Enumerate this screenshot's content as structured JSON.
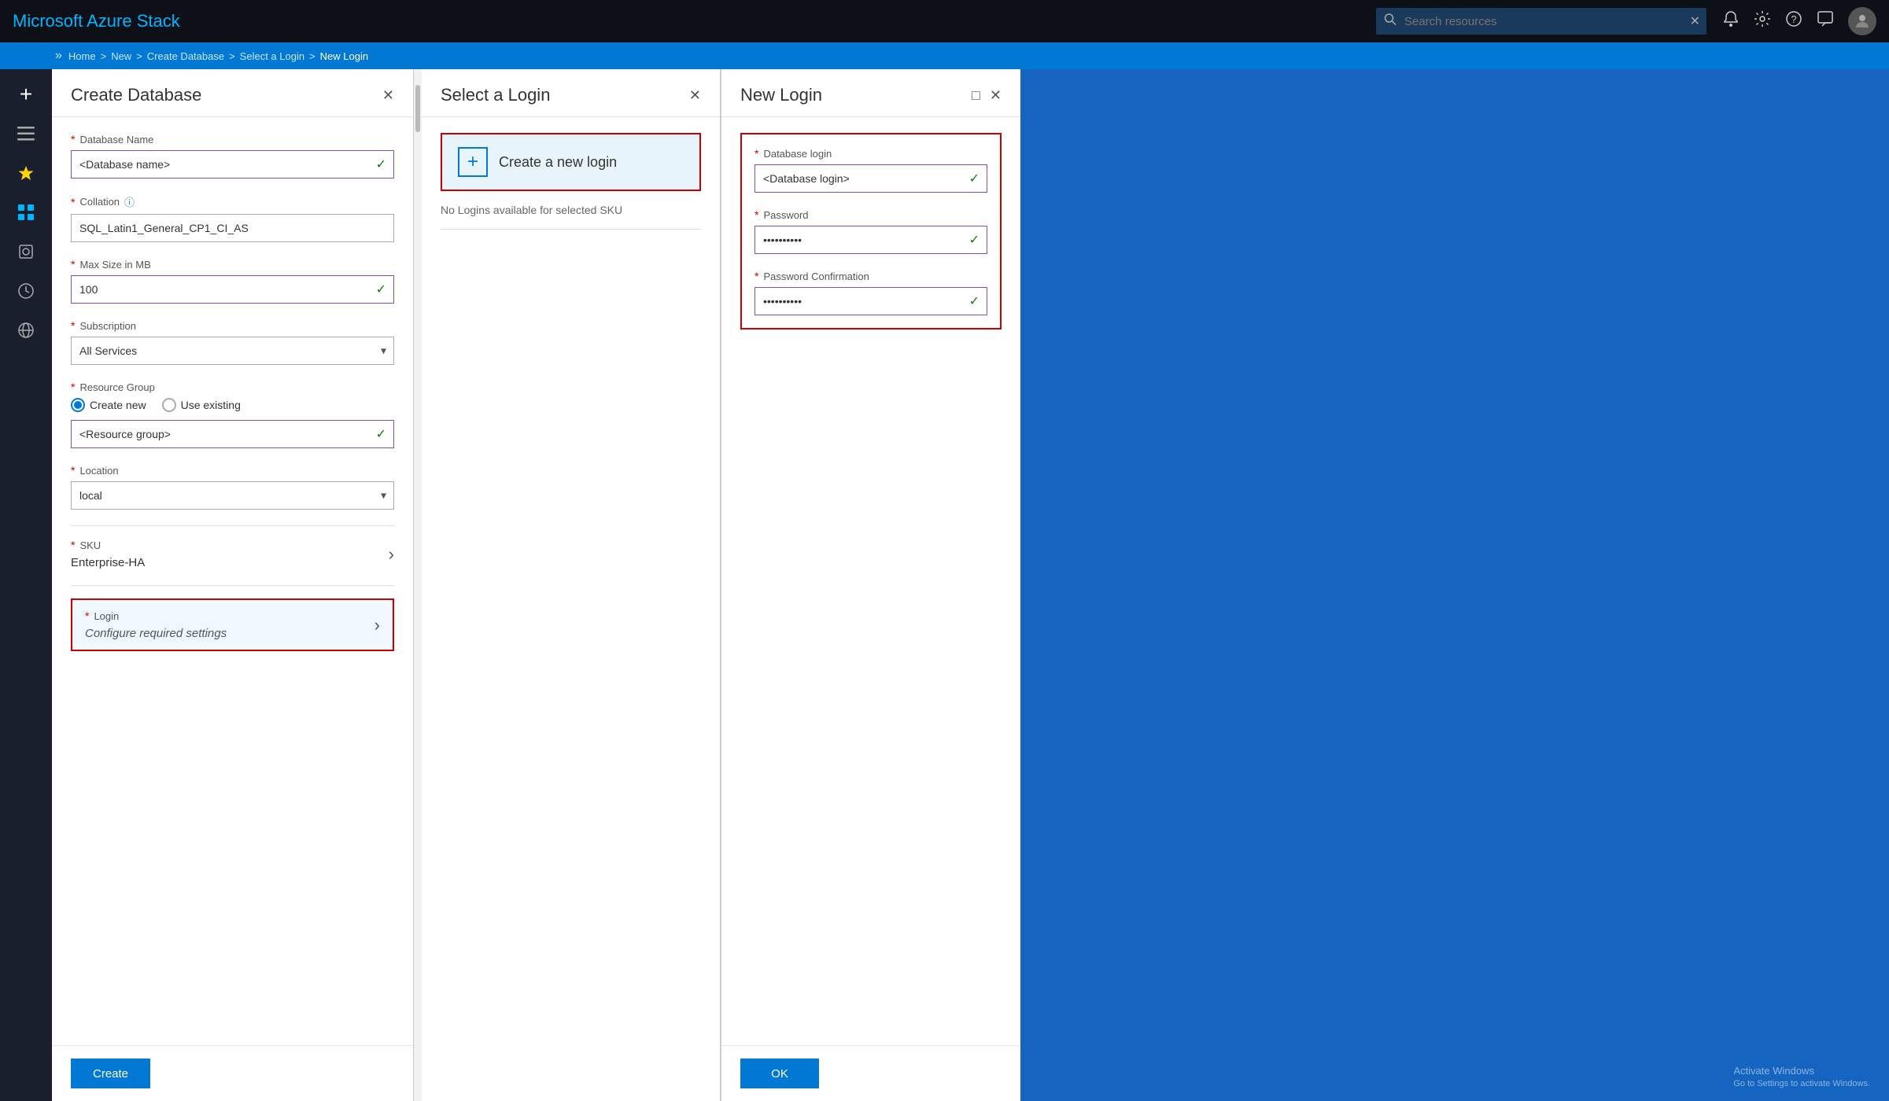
{
  "app": {
    "title": "Microsoft Azure Stack"
  },
  "topbar": {
    "search_placeholder": "Search resources",
    "clear_label": "✕"
  },
  "breadcrumb": {
    "items": [
      "Home",
      "New",
      "Create Database",
      "Select a Login",
      "New Login"
    ]
  },
  "sidebar": {
    "plus_label": "+",
    "items": [
      {
        "name": "menu-icon",
        "icon": "☰"
      },
      {
        "name": "star-icon",
        "icon": "★"
      },
      {
        "name": "grid-icon",
        "icon": "▦"
      },
      {
        "name": "cube-icon",
        "icon": "◈"
      },
      {
        "name": "clock-icon",
        "icon": "⏱"
      },
      {
        "name": "globe-icon",
        "icon": "🌐"
      }
    ]
  },
  "create_database_panel": {
    "title": "Create Database",
    "close_label": "✕",
    "fields": {
      "database_name": {
        "label": "Database Name",
        "placeholder": "<Database name>",
        "value": "<Database name>",
        "has_check": true
      },
      "collation": {
        "label": "Collation",
        "value": "SQL_Latin1_General_CP1_CI_AS"
      },
      "max_size": {
        "label": "Max Size in MB",
        "value": "100",
        "has_check": true
      },
      "subscription": {
        "label": "Subscription",
        "value": "All Services",
        "options": [
          "All Services"
        ]
      },
      "resource_group": {
        "label": "Resource Group",
        "radio_create": "Create new",
        "radio_use": "Use existing",
        "placeholder": "<Resource group>",
        "value": "<Resource group>",
        "has_check": true
      },
      "location": {
        "label": "Location",
        "value": "local",
        "options": [
          "local"
        ]
      },
      "sku": {
        "label": "SKU",
        "value": "Enterprise-HA"
      },
      "login": {
        "label": "Login",
        "value": "Configure required settings"
      }
    },
    "create_button": "Create"
  },
  "select_login_panel": {
    "title": "Select a Login",
    "close_label": "✕",
    "create_new_label": "Create a new login",
    "no_logins_text": "No Logins available for selected SKU"
  },
  "new_login_panel": {
    "title": "New Login",
    "close_label": "✕",
    "maximize_label": "□",
    "fields": {
      "database_login": {
        "label": "Database login",
        "value": "<Database login>",
        "has_check": true
      },
      "password": {
        "label": "Password",
        "value": "••••••••••",
        "has_check": true
      },
      "password_confirmation": {
        "label": "Password Confirmation",
        "value": "••••••••••",
        "has_check": true
      }
    },
    "ok_button": "OK"
  },
  "colors": {
    "required_star": "#c00",
    "border_highlight": "#8b4e9e",
    "check_green": "#107c10",
    "error_red": "#c00",
    "primary_blue": "#0078d4",
    "accent_blue": "#00b4ff"
  }
}
